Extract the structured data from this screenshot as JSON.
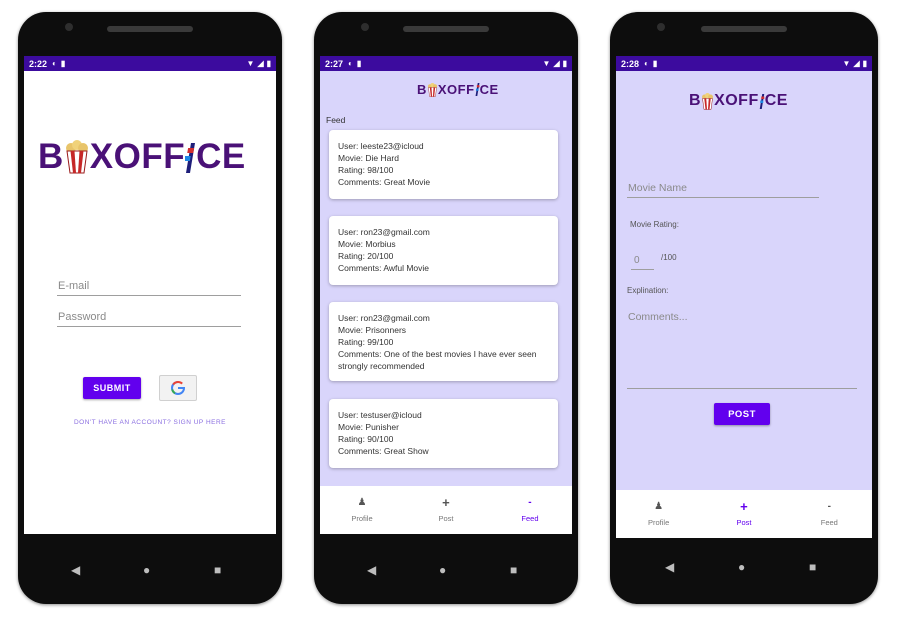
{
  "phones": [
    {
      "status": {
        "time": "2:22"
      }
    },
    {
      "status": {
        "time": "2:27"
      }
    },
    {
      "status": {
        "time": "2:28"
      }
    }
  ],
  "logo": {
    "text_start": "B",
    "text_end": "XOFF",
    "text_tail": "CE"
  },
  "login": {
    "email_placeholder": "E-mail",
    "password_placeholder": "Password",
    "submit_label": "SUBMIT",
    "signup_link": "DON'T HAVE AN ACCOUNT? SIGN UP HERE"
  },
  "feed": {
    "title": "Feed",
    "posts": [
      {
        "user": "User: leeste23@icloud",
        "movie": "Movie: Die Hard",
        "rating": "Rating: 98/100",
        "comments": "Comments: Great Movie"
      },
      {
        "user": "User: ron23@gmail.com",
        "movie": "Movie: Morbius",
        "rating": "Rating: 20/100",
        "comments": "Comments: Awful Movie"
      },
      {
        "user": "User: ron23@gmail.com",
        "movie": "Movie: Prisonners",
        "rating": "Rating: 99/100",
        "comments": "Comments: One of the best movies I have ever seen strongly recommended"
      },
      {
        "user": "User: testuser@icloud",
        "movie": "Movie: Punisher",
        "rating": "Rating: 90/100",
        "comments": "Comments: Great Show"
      }
    ]
  },
  "post": {
    "movie_name_placeholder": "Movie Name",
    "rating_label": "Movie Rating:",
    "rating_placeholder": "0",
    "rating_suffix": "/100",
    "explanation_label": "Explination:",
    "comments_placeholder": "Comments...",
    "post_label": "POST"
  },
  "nav": {
    "profile": {
      "icon": "person-icon",
      "glyph": "♟",
      "label": "Profile"
    },
    "post": {
      "icon": "plus-icon",
      "glyph": "+",
      "label": "Post"
    },
    "feed": {
      "icon": "minus-icon",
      "glyph": "-",
      "label": "Feed"
    }
  },
  "colors": {
    "status_bar": "#3c0b9e",
    "accent": "#6200ee",
    "feed_bg": "#d9d5fb",
    "logo": "#4a1177"
  }
}
